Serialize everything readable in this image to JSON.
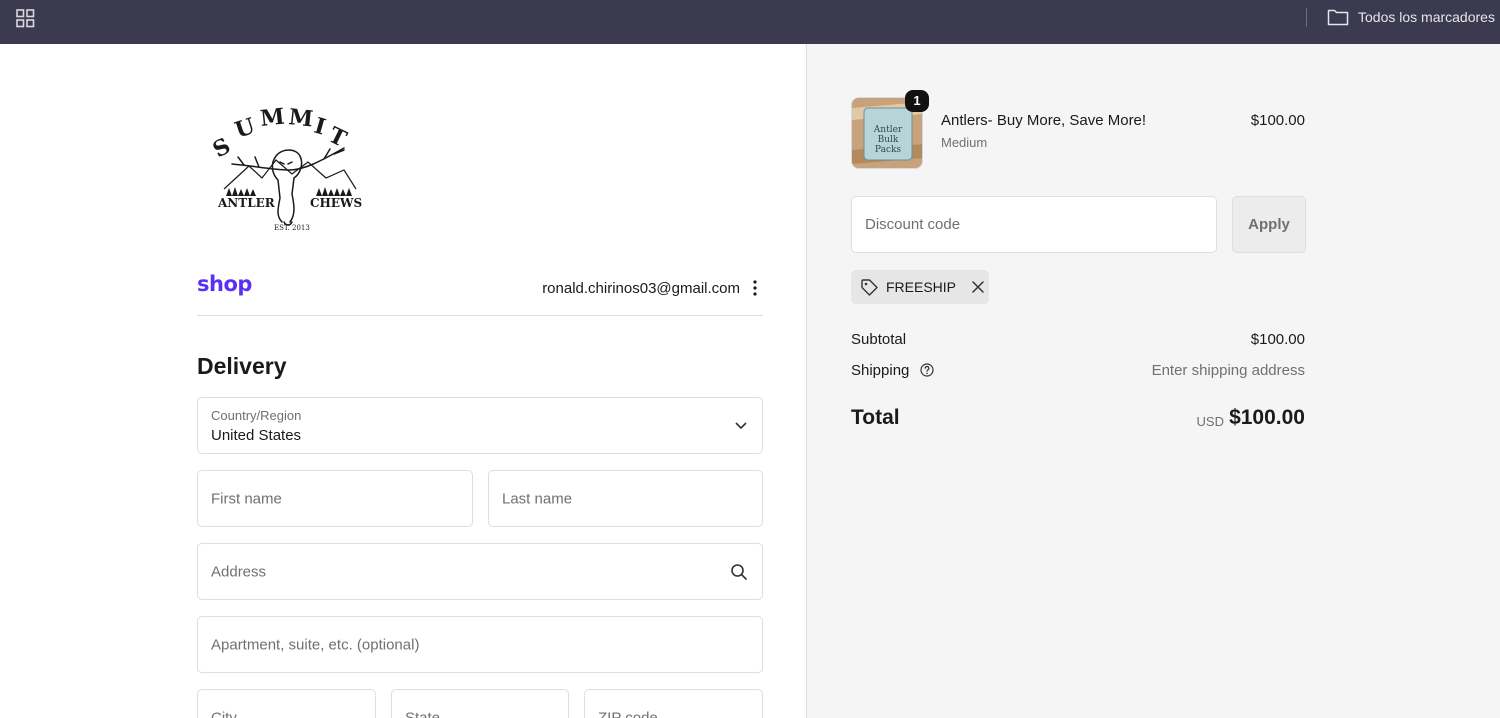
{
  "browser": {
    "bookmarks_label": "Todos los marcadores"
  },
  "brand": {
    "logo_text_top": "SUMMIT",
    "logo_text_left": "ANTLER",
    "logo_text_right": "CHEWS",
    "logo_text_est": "EST. 2013"
  },
  "account": {
    "shop_logo": "shop",
    "email": "ronald.chirinos03@gmail.com"
  },
  "delivery": {
    "title": "Delivery",
    "country_label": "Country/Region",
    "country_value": "United States",
    "first_name_placeholder": "First name",
    "last_name_placeholder": "Last name",
    "address_placeholder": "Address",
    "apartment_placeholder": "Apartment, suite, etc. (optional)",
    "city_placeholder": "City",
    "state_placeholder": "State",
    "zip_placeholder": "ZIP code"
  },
  "cart": {
    "item": {
      "quantity": "1",
      "title": "Antlers- Buy More, Save More!",
      "variant": "Medium",
      "price": "$100.00",
      "thumb_text": "Antler Bulk Packs"
    },
    "discount_placeholder": "Discount code",
    "apply_label": "Apply",
    "applied_code": "FREESHIP",
    "subtotal_label": "Subtotal",
    "subtotal_value": "$100.00",
    "shipping_label": "Shipping",
    "shipping_value": "Enter shipping address",
    "total_label": "Total",
    "total_currency": "USD",
    "total_value": "$100.00"
  },
  "colors": {
    "browser_bar": "#3c3a4f",
    "shop_brand": "#5a31f4",
    "summary_bg": "#f5f5f5"
  }
}
